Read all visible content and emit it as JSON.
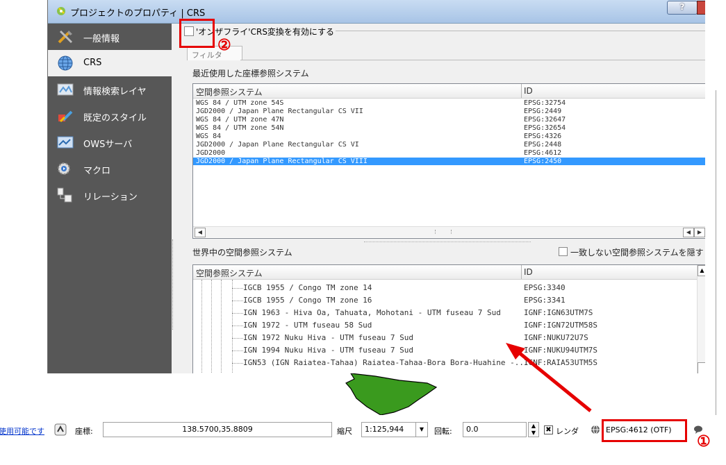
{
  "window": {
    "title": "プロジェクトのプロパティ | CRS",
    "help_label": "?"
  },
  "sidebar": {
    "items": [
      {
        "label": "一般情報"
      },
      {
        "label": "CRS"
      },
      {
        "label": "情報検索レイヤ"
      },
      {
        "label": "既定のスタイル"
      },
      {
        "label": "OWSサーバ"
      },
      {
        "label": "マクロ"
      },
      {
        "label": "リレーション"
      }
    ]
  },
  "otf": {
    "label": "'オンザフライ'CRS変換を有効にする"
  },
  "filter": {
    "label": "フィルタ"
  },
  "recent": {
    "title": "最近使用した座標参照システム",
    "col1": "空間参照システム",
    "col2": "ID",
    "rows": [
      {
        "name": "WGS 84 / UTM zone 54S",
        "id": "EPSG:32754"
      },
      {
        "name": "JGD2000 / Japan Plane Rectangular CS VII",
        "id": "EPSG:2449"
      },
      {
        "name": "WGS 84 / UTM zone 47N",
        "id": "EPSG:32647"
      },
      {
        "name": "WGS 84 / UTM zone 54N",
        "id": "EPSG:32654"
      },
      {
        "name": "WGS 84",
        "id": "EPSG:4326"
      },
      {
        "name": "JGD2000 / Japan Plane Rectangular CS VI",
        "id": "EPSG:2448"
      },
      {
        "name": "JGD2000",
        "id": "EPSG:4612"
      },
      {
        "name": "JGD2000 / Japan Plane Rectangular CS VIII",
        "id": "EPSG:2450"
      }
    ],
    "selected_index": 7
  },
  "world": {
    "title": "世界中の空間参照システム",
    "hide_label": "一致しない空間参照システムを隠す",
    "col1": "空間参照システム",
    "col2": "ID",
    "rows": [
      {
        "name": "IGCB 1955 / Congo TM zone 14",
        "id": "EPSG:3340"
      },
      {
        "name": "IGCB 1955 / Congo TM zone 16",
        "id": "EPSG:3341"
      },
      {
        "name": "IGN 1963 - Hiva Oa, Tahuata, Mohotani - UTM fuseau 7 Sud",
        "id": "IGNF:IGN63UTM7S"
      },
      {
        "name": "IGN 1972 - UTM fuseau 58 Sud",
        "id": "IGNF:IGN72UTM58S"
      },
      {
        "name": "IGN 1972 Nuku Hiva - UTM fuseau 7 Sud",
        "id": "IGNF:NUKU72U7S"
      },
      {
        "name": "IGN 1994 Nuku Hiva - UTM fuseau 7 Sud",
        "id": "IGNF:NUKU94UTM7S"
      },
      {
        "name": "IGN53 (IGN Raiatea-Tahaa) Raiatea-Tahaa-Bora Bora-Huahine -...",
        "id": "IGNF:RAIA53UTM5S"
      }
    ]
  },
  "statusbar": {
    "link_text": "使用可能です",
    "coord_label": "座標:",
    "coord_value": "138.5700,35.8809",
    "scale_label": "縮尺",
    "scale_value": "1:125,944",
    "rotation_label": "回転:",
    "rotation_value": "0.0",
    "render_label": "レンダ",
    "crs_label": "EPSG:4612 (OTF)"
  },
  "annotations": {
    "one": "①",
    "two": "②"
  },
  "colors": {
    "accent_red": "#e60000",
    "selection": "#3399ff",
    "sidebar": "#575757",
    "map_green": "#3a9a1e"
  }
}
